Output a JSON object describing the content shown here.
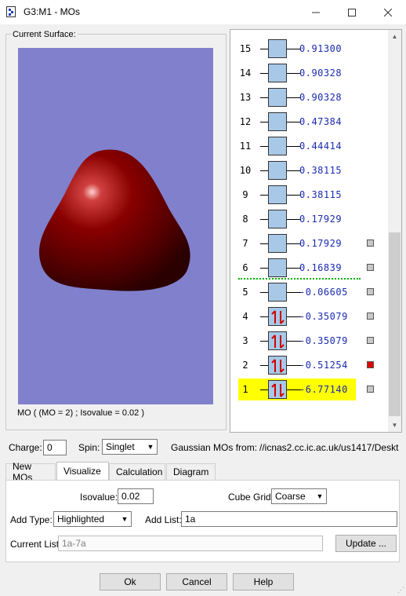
{
  "window": {
    "title": "G3:M1 - MOs"
  },
  "surface": {
    "group_label": "Current Surface:",
    "caption": "MO ( (MO = 2) ; Isovalue = 0.02 )",
    "background_color": "#8080cc",
    "blob_color": "#7a0000"
  },
  "orbitals": [
    {
      "num": "15",
      "energy": "0.91300",
      "occupied": false,
      "swatch": ""
    },
    {
      "num": "14",
      "energy": "0.90328",
      "occupied": false,
      "swatch": ""
    },
    {
      "num": "13",
      "energy": "0.90328",
      "occupied": false,
      "swatch": ""
    },
    {
      "num": "12",
      "energy": "0.47384",
      "occupied": false,
      "swatch": ""
    },
    {
      "num": "11",
      "energy": "0.44414",
      "occupied": false,
      "swatch": ""
    },
    {
      "num": "10",
      "energy": "0.38115",
      "occupied": false,
      "swatch": ""
    },
    {
      "num": "9",
      "energy": "0.38115",
      "occupied": false,
      "swatch": ""
    },
    {
      "num": "8",
      "energy": "0.17929",
      "occupied": false,
      "swatch": ""
    },
    {
      "num": "7",
      "energy": "0.17929",
      "occupied": false,
      "swatch": "#c8c8c8"
    },
    {
      "num": "6",
      "energy": "0.16839",
      "occupied": false,
      "swatch": "#c8c8c8"
    },
    {
      "num": "5",
      "energy": "-0.06605",
      "occupied": false,
      "swatch": "#c8c8c8"
    },
    {
      "num": "4",
      "energy": "-0.35079",
      "occupied": true,
      "swatch": "#c8c8c8"
    },
    {
      "num": "3",
      "energy": "-0.35079",
      "occupied": true,
      "swatch": "#c8c8c8"
    },
    {
      "num": "2",
      "energy": "-0.51254",
      "occupied": true,
      "swatch": "#e00000"
    },
    {
      "num": "1",
      "energy": "-6.77140",
      "occupied": true,
      "swatch": "#c8c8c8",
      "highlighted": true
    }
  ],
  "info_bar": {
    "charge_label": "Charge:",
    "charge_value": "0",
    "spin_label": "Spin:",
    "spin_value": "Singlet",
    "source_label": "Gaussian MOs from:",
    "source_value": "//icnas2.cc.ic.ac.uk/us1417/Deskt"
  },
  "tabs": [
    "New MOs",
    "Visualize",
    "Calculation",
    "Diagram"
  ],
  "active_tab": "Visualize",
  "visualize": {
    "isovalue_label": "Isovalue:",
    "isovalue_value": "0.02",
    "cube_grid_label": "Cube Grid:",
    "cube_grid_value": "Coarse",
    "add_type_label": "Add Type:",
    "add_type_value": "Highlighted",
    "add_list_label": "Add List:",
    "add_list_value": "1a",
    "current_list_label": "Current List:",
    "current_list_value": "1a-7a",
    "update_button": "Update ..."
  },
  "buttons": {
    "ok": "Ok",
    "cancel": "Cancel",
    "help": "Help"
  },
  "colors": {
    "energy_text": "#1a2ab0",
    "orbital_box": "#a8c8e8",
    "homo_lumo_line": "#00b000",
    "highlight": "#ffff00",
    "electron_arrow": "#d00000"
  }
}
